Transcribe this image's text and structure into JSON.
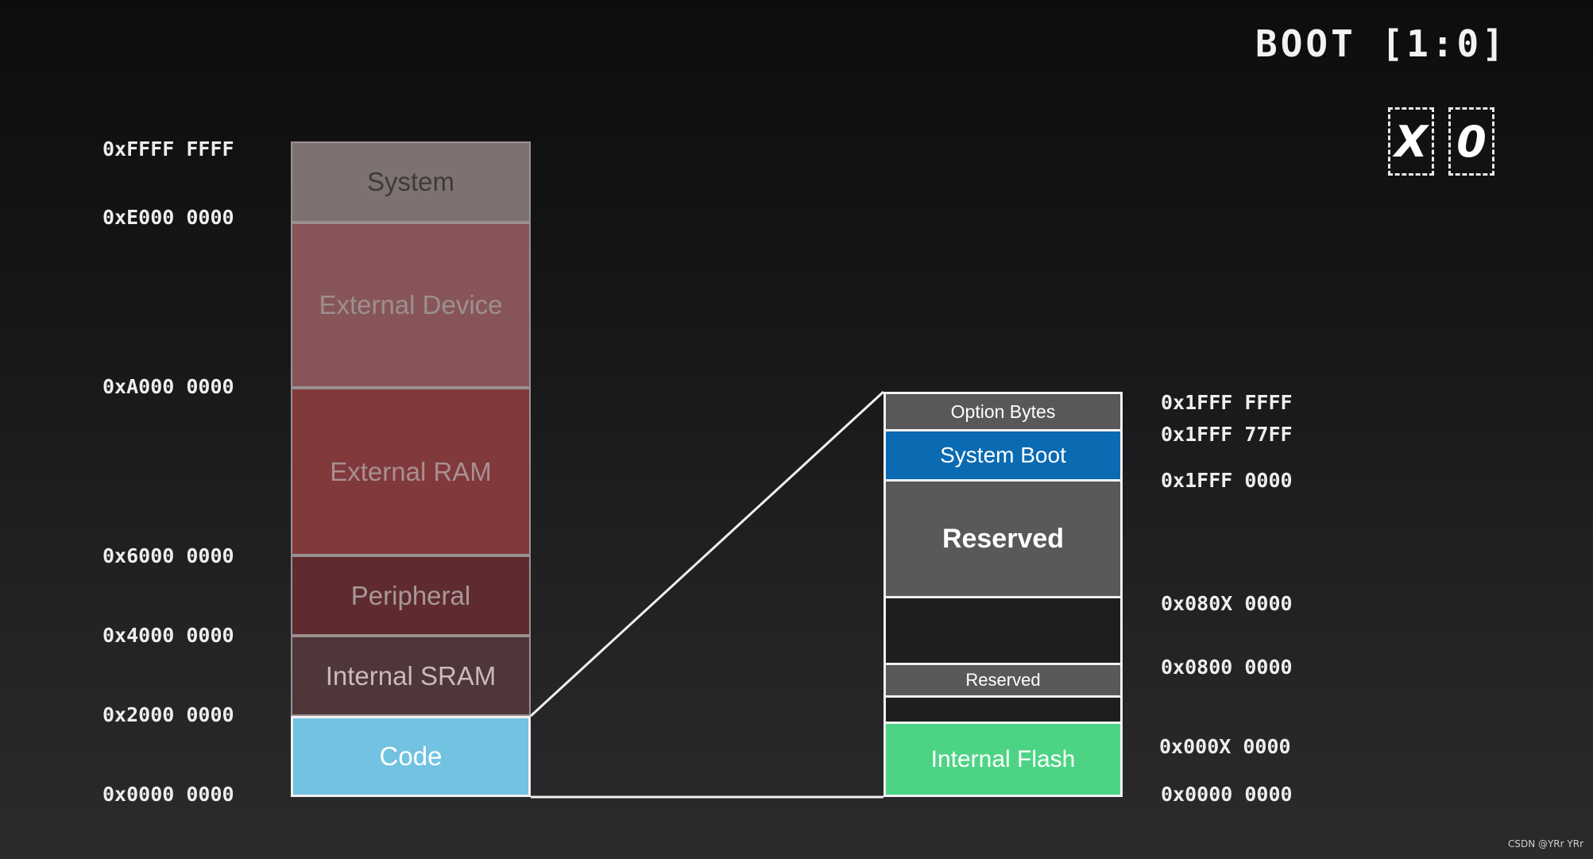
{
  "boot": {
    "title": "BOOT [1:0]",
    "bit1": "X",
    "bit0": "0"
  },
  "memory_map": {
    "address_labels": [
      "0xFFFF FFFF",
      "0xE000 0000",
      "0xA000 0000",
      "0x6000 0000",
      "0x4000 0000",
      "0x2000 0000",
      "0x0000 0000"
    ],
    "regions": [
      {
        "label": "System",
        "bg": "#7d7270",
        "fg": "#3e3a3a"
      },
      {
        "label": "External Device",
        "bg": "#875558",
        "fg": "#9d8f8f"
      },
      {
        "label": "External RAM",
        "bg": "#81393c",
        "fg": "#a89090"
      },
      {
        "label": "Peripheral",
        "bg": "#5f2b2f",
        "fg": "#a89898"
      },
      {
        "label": "Internal SRAM",
        "bg": "#4f3638",
        "fg": "#c8baba"
      },
      {
        "label": "Code",
        "bg": "#72c2e2",
        "fg": "#ffffff"
      }
    ]
  },
  "code_region_detail": {
    "address_labels": [
      "0x1FFF FFFF",
      "0x1FFF 77FF",
      "0x1FFF 0000",
      "0x080X 0000",
      "0x0800 0000",
      "0x000X 0000",
      "0x0000 0000"
    ],
    "regions": [
      {
        "label": "Option Bytes",
        "bg": "#58585a",
        "fg": "#ffffff"
      },
      {
        "label": "System Boot",
        "bg": "#0a6ab2",
        "fg": "#ffffff"
      },
      {
        "label": "Reserved",
        "bg": "#59595b",
        "fg": "#ffffff"
      },
      {
        "label": "",
        "bg": "#1e1d1f",
        "fg": "#ffffff"
      },
      {
        "label": "Reserved",
        "bg": "#59595b",
        "fg": "#ffffff"
      },
      {
        "label": "",
        "bg": "#1e1d1f",
        "fg": "#ffffff"
      },
      {
        "label": "Internal Flash",
        "bg": "#4cd484",
        "fg": "#ffffff"
      }
    ]
  },
  "watermark": "CSDN @YRr YRr"
}
